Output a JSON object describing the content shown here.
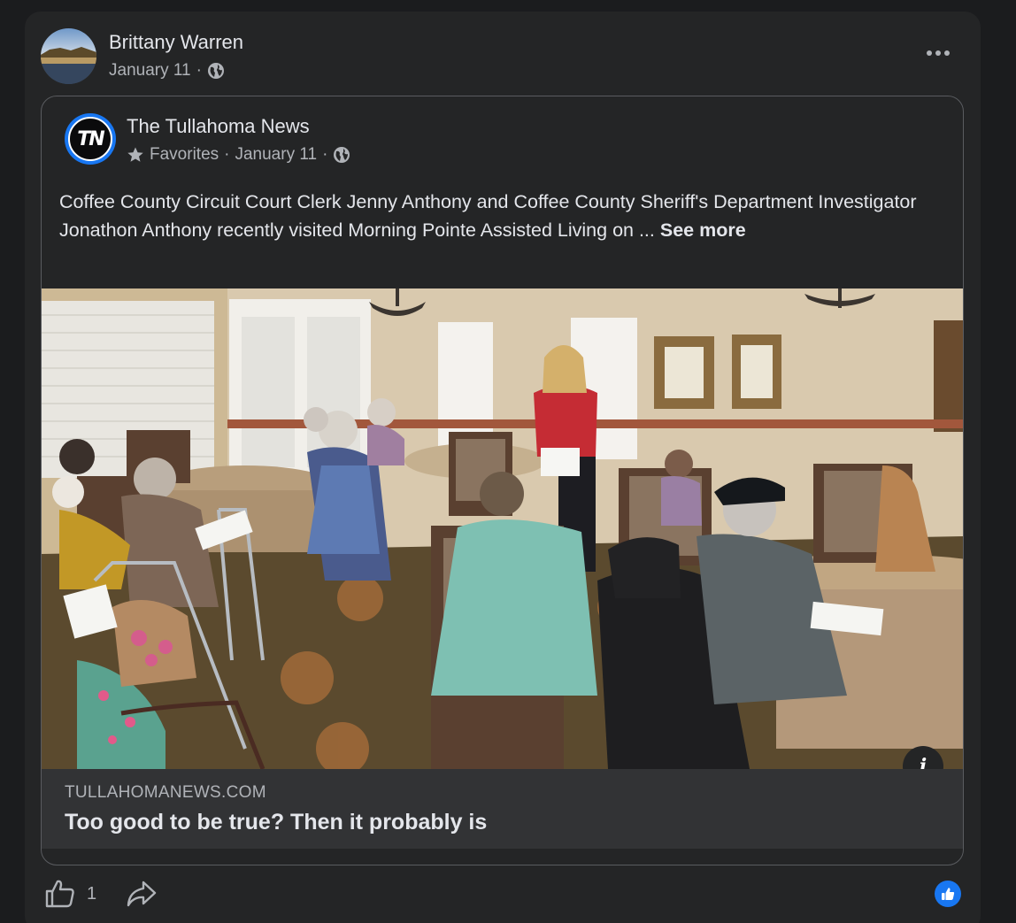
{
  "post": {
    "author": "Brittany Warren",
    "date": "January 11",
    "separator": "·",
    "privacy_icon": "globe-icon",
    "more_icon": "more-options-icon"
  },
  "shared": {
    "page_name": "The Tullahoma News",
    "logo_text": "TN",
    "favorites": "Favorites",
    "separator": "·",
    "date": "January 11",
    "text": "Coffee County Circuit Court Clerk Jenny Anthony and Coffee County Sheriff's Department Investigator Jonathon Anthony recently visited Morning Pointe Assisted Living on ...",
    "see_more": "See more",
    "info_label": "i",
    "link_domain": "TULLAHOMANEWS.COM",
    "link_title": "Too good to be true? Then it probably is"
  },
  "footer": {
    "like_count": "1",
    "like_icon": "thumbs-up-icon",
    "share_icon": "share-arrow-icon",
    "reaction_icon": "like-reaction-icon"
  },
  "colors": {
    "background": "#1b1c1e",
    "card": "#242526",
    "link_bar": "#323335",
    "text_primary": "#e4e6eb",
    "text_secondary": "#b0b3b8",
    "accent": "#1877f2"
  }
}
